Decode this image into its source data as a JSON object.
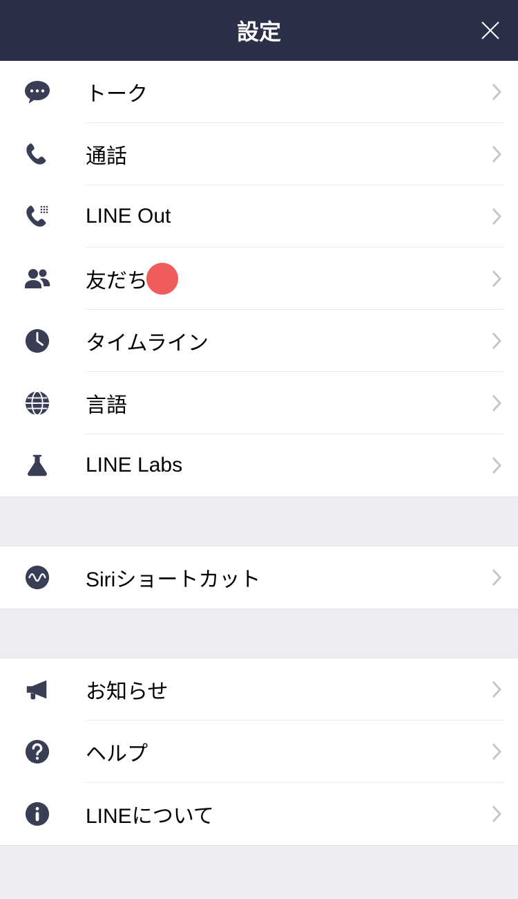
{
  "header": {
    "title": "設定"
  },
  "sections": [
    {
      "items": [
        {
          "label": "トーク",
          "icon": "chat",
          "badge": false
        },
        {
          "label": "通話",
          "icon": "phone",
          "badge": false
        },
        {
          "label": "LINE Out",
          "icon": "phone-out",
          "badge": false
        },
        {
          "label": "友だち",
          "icon": "friends",
          "badge": true
        },
        {
          "label": "タイムライン",
          "icon": "clock",
          "badge": false
        },
        {
          "label": "言語",
          "icon": "globe",
          "badge": false
        },
        {
          "label": "LINE Labs",
          "icon": "flask",
          "badge": false
        }
      ]
    },
    {
      "items": [
        {
          "label": "Siriショートカット",
          "icon": "siri",
          "badge": false
        }
      ]
    },
    {
      "items": [
        {
          "label": "お知らせ",
          "icon": "megaphone",
          "badge": false
        },
        {
          "label": "ヘルプ",
          "icon": "help",
          "badge": false
        },
        {
          "label": "LINEについて",
          "icon": "info",
          "badge": false
        }
      ]
    }
  ]
}
